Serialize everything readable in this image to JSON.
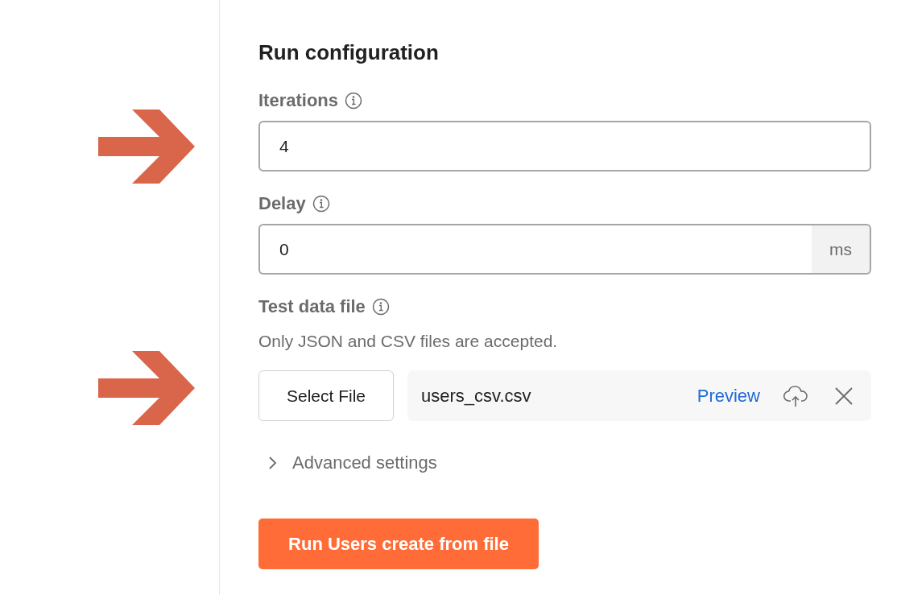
{
  "title": "Run configuration",
  "fields": [
    {
      "kind": "number",
      "label": "Iterations",
      "info": true,
      "value": "4",
      "marked": true
    },
    {
      "kind": "number",
      "label": "Delay",
      "info": true,
      "value": "0",
      "unit": "ms",
      "marked": false
    },
    {
      "kind": "file",
      "label": "Test data file",
      "info": true,
      "hint": "Only JSON and CSV files are accepted.",
      "button": "Select File",
      "file_name": "users_csv.csv",
      "preview": "Preview",
      "marked": true
    }
  ],
  "advanced": {
    "label": "Advanced settings",
    "expanded": false
  },
  "run_button": "Run Users create from file"
}
